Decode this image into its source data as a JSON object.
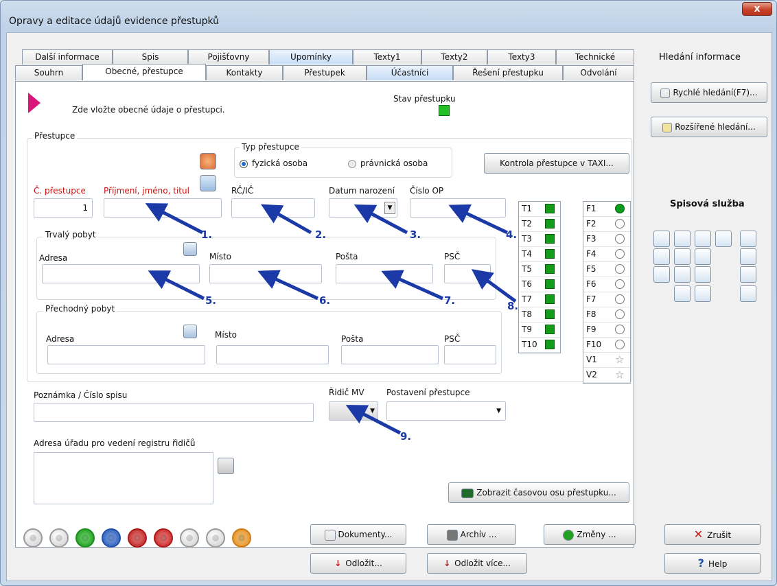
{
  "window": {
    "title": "Opravy a editace údajů evidence přestupků",
    "close_label": "x"
  },
  "tabs_top": [
    {
      "label": "Další informace"
    },
    {
      "label": "Spis"
    },
    {
      "label": "Pojišťovny"
    },
    {
      "label": "Upomínky"
    },
    {
      "label": "Texty1"
    },
    {
      "label": "Texty2"
    },
    {
      "label": "Texty3"
    },
    {
      "label": "Technické"
    }
  ],
  "tabs_bottom": [
    {
      "label": "Souhrn"
    },
    {
      "label": "Obecné, přestupce"
    },
    {
      "label": "Kontakty"
    },
    {
      "label": "Přestupek"
    },
    {
      "label": "Účastníci"
    },
    {
      "label": "Řešení přestupku"
    },
    {
      "label": "Odvolání"
    }
  ],
  "header": {
    "hint": "Zde vložte obecné údaje o přestupci.",
    "status_label": "Stav přestupku",
    "status_color": "#22c022"
  },
  "prestupce": {
    "group_title": "Přestupce",
    "type_group_title": "Typ přestupce",
    "type_options": [
      "fyzická osoba",
      "právnická osoba"
    ],
    "check_button": "Kontrola přestupce v TAXI...",
    "fields": {
      "cislo_label": "Č. přestupce",
      "cislo_value": "1",
      "jmeno_label": "Příjmení, jméno, titul",
      "rc_label": "RČ/IČ",
      "datum_label": "Datum narození",
      "op_label": "Číslo OP"
    }
  },
  "trvaly": {
    "title": "Trvalý pobyt",
    "adresa": "Adresa",
    "misto": "Místo",
    "posta": "Pošta",
    "psc": "PSČ"
  },
  "prechodny": {
    "title": "Přechodný pobyt",
    "adresa": "Adresa",
    "misto": "Místo",
    "posta": "Pošta",
    "psc": "PSČ"
  },
  "poznamka_label": "Poznámka / Číslo spisu",
  "ridic_label": "Řidič MV",
  "postaveni_label": "Postavení přestupce",
  "adresa_uradu_label": "Adresa úřadu pro vedení registru řidičů",
  "timeline_button": "Zobrazit časovou osu přestupku...",
  "arrows": [
    "1.",
    "2.",
    "3.",
    "4.",
    "5.",
    "6.",
    "7.",
    "8.",
    "9."
  ],
  "t_rows": [
    "T1",
    "T2",
    "T3",
    "T4",
    "T5",
    "T6",
    "T7",
    "T8",
    "T9",
    "T10"
  ],
  "f_rows": [
    "F1",
    "F2",
    "F3",
    "F4",
    "F5",
    "F6",
    "F7",
    "F8",
    "F9",
    "F10",
    "V1",
    "V2"
  ],
  "sidebar": {
    "search_title": "Hledání informace",
    "quick_search": "Rychlé hledání(F7)...",
    "advanced_search": "Rozšířené hledání...",
    "spis_title": "Spisová služba"
  },
  "bottom": {
    "dokumenty": "Dokumenty...",
    "archiv": "Archív ...",
    "zmeny": "Změny ...",
    "zrusit": "Zrušit",
    "odlozit": "Odložit...",
    "odlozit_vice": "Odložit více...",
    "help": "Help"
  }
}
